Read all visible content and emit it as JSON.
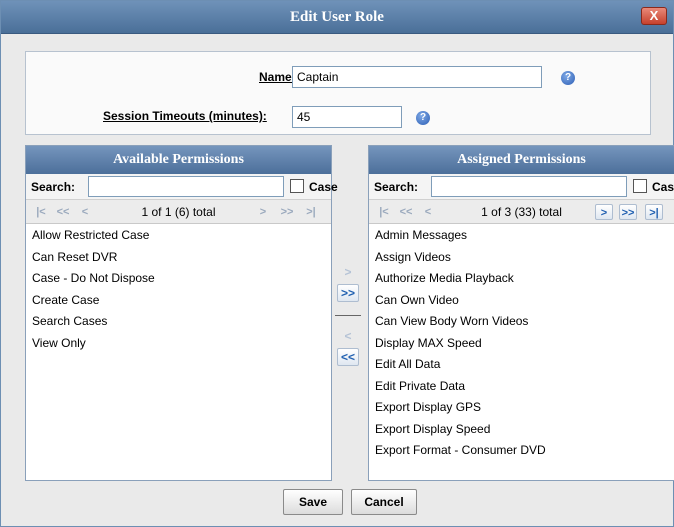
{
  "dialog": {
    "title": "Edit User Role",
    "close_label": "X"
  },
  "form": {
    "name_label": "Name:",
    "name_value": "Captain",
    "timeout_label": "Session Timeouts (minutes):",
    "timeout_value": "45",
    "help_glyph": "?"
  },
  "available": {
    "header": "Available Permissions",
    "search_label": "Search:",
    "search_value": "",
    "case_label": "Case",
    "pager_text": "1 of 1 (6) total",
    "items": [
      "Allow Restricted Case",
      "Can Reset DVR",
      "Case - Do Not Dispose",
      "Create Case",
      "Search Cases",
      "View Only"
    ]
  },
  "assigned": {
    "header": "Assigned Permissions",
    "search_label": "Search:",
    "search_value": "",
    "case_label": "Case",
    "pager_text": "1 of 3 (33) total",
    "items": [
      "Admin Messages",
      "Assign Videos",
      "Authorize Media Playback",
      "Can Own Video",
      "Can View Body Worn Videos",
      "Display MAX Speed",
      "Edit All Data",
      "Edit Private Data",
      "Export Display GPS",
      "Export Display Speed",
      "Export Format - Consumer DVD"
    ]
  },
  "pager_glyphs": {
    "first": "|<",
    "prev_page": "<<",
    "prev": "<",
    "next": ">",
    "next_page": ">>",
    "last": ">|"
  },
  "transfer": {
    "add_one": ">",
    "add_all": ">>",
    "remove_one": "<",
    "remove_all": "<<"
  },
  "buttons": {
    "save": "Save",
    "cancel": "Cancel"
  },
  "colors": {
    "title_bar": "#5b80aa",
    "panel_header": "#5f82ad",
    "accent": "#1f5fb0",
    "close": "#c6412d"
  },
  "icons": {
    "help": "help-icon",
    "close": "close-icon"
  }
}
